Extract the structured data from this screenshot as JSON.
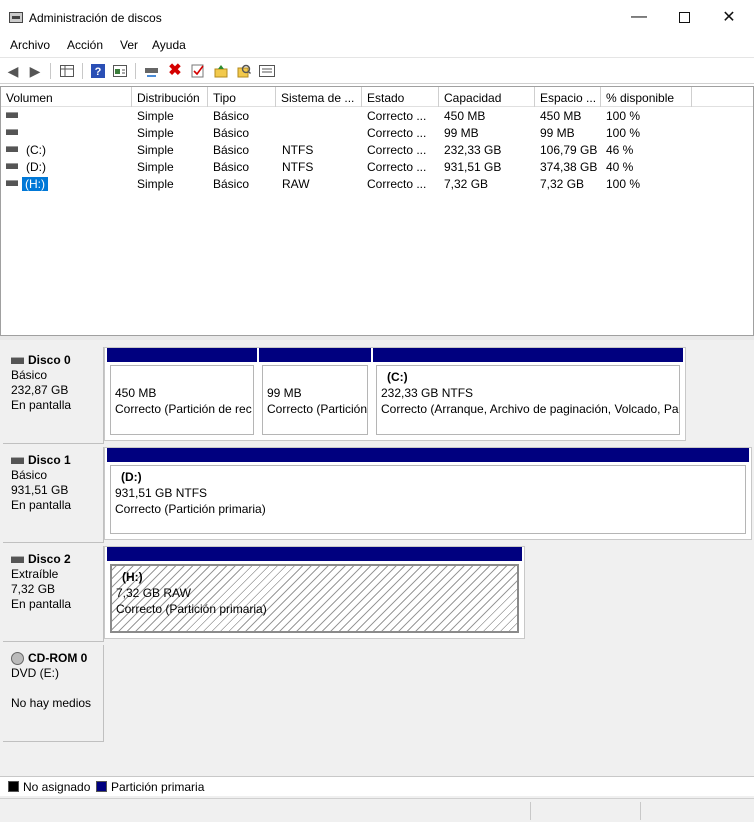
{
  "window": {
    "title": "Administración de discos"
  },
  "menu": [
    "Archivo",
    "Acción",
    "Ver",
    "Ayuda"
  ],
  "toolbar_icons": [
    "back-arrow-icon",
    "forward-arrow-icon",
    "console-tree-icon",
    "help-icon",
    "properties-pane-icon",
    "connect-drive-icon",
    "delete-icon",
    "check-icon",
    "folder-up-icon",
    "search-icon",
    "list-view-icon"
  ],
  "columns": [
    "Volumen",
    "Distribución",
    "Tipo",
    "Sistema de ...",
    "Estado",
    "Capacidad",
    "Espacio ...",
    "% disponible"
  ],
  "volumes": [
    {
      "name": "",
      "layout": "Simple",
      "type": "Básico",
      "fs": "",
      "status": "Correcto ...",
      "capacity": "450 MB",
      "free": "450 MB",
      "pct": "100 %"
    },
    {
      "name": "",
      "layout": "Simple",
      "type": "Básico",
      "fs": "",
      "status": "Correcto ...",
      "capacity": "99 MB",
      "free": "99 MB",
      "pct": "100 %"
    },
    {
      "name": "(C:)",
      "layout": "Simple",
      "type": "Básico",
      "fs": "NTFS",
      "status": "Correcto ...",
      "capacity": "232,33 GB",
      "free": "106,79 GB",
      "pct": "46 %"
    },
    {
      "name": "(D:)",
      "layout": "Simple",
      "type": "Básico",
      "fs": "NTFS",
      "status": "Correcto ...",
      "capacity": "931,51 GB",
      "free": "374,38 GB",
      "pct": "40 %"
    },
    {
      "name": "(H:)",
      "layout": "Simple",
      "type": "Básico",
      "fs": "RAW",
      "status": "Correcto ...",
      "capacity": "7,32 GB",
      "free": "7,32 GB",
      "pct": "100 %"
    }
  ],
  "disks": [
    {
      "name": "Disco 0",
      "type": "Básico",
      "size": "232,87 GB",
      "state": "En pantalla",
      "partitions": [
        {
          "name": "",
          "size": "450 MB",
          "status": "Correcto (Partición de rec"
        },
        {
          "name": "",
          "size": "99 MB",
          "status": "Correcto (Partición"
        },
        {
          "name": "(C:)",
          "size": "232,33 GB NTFS",
          "status": "Correcto (Arranque, Archivo de paginación, Volcado, Pa"
        }
      ]
    },
    {
      "name": "Disco 1",
      "type": "Básico",
      "size": "931,51 GB",
      "state": "En pantalla",
      "partitions": [
        {
          "name": "(D:)",
          "size": "931,51 GB NTFS",
          "status": "Correcto (Partición primaria)"
        }
      ]
    },
    {
      "name": "Disco 2",
      "type": "Extraíble",
      "size": "7,32 GB",
      "state": "En pantalla",
      "partitions": [
        {
          "name": "(H:)",
          "size": "7,32 GB RAW",
          "status": "Correcto (Partición primaria)"
        }
      ]
    },
    {
      "name": "CD-ROM 0",
      "type": "DVD (E:)",
      "size": "",
      "state": "No hay medios"
    }
  ],
  "legend": [
    {
      "label": "No asignado",
      "color": "#000000"
    },
    {
      "label": "Partición primaria",
      "color": "#00007f"
    }
  ]
}
